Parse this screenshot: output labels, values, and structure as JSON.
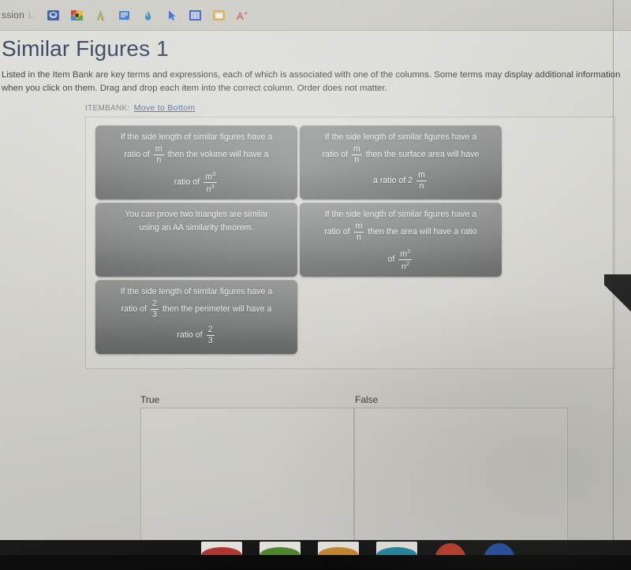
{
  "browser": {
    "tab_title": "ssion",
    "tab_title_faded": "L",
    "bookmarks": [
      {
        "name": "shield-badge-icon",
        "color": "#2a4f9b"
      },
      {
        "name": "colorful-diamond-icon",
        "color": "#c9332a"
      },
      {
        "name": "triangle-a-icon",
        "color": "#8a9a4a"
      },
      {
        "name": "document-lines-icon",
        "color": "#2f6fd0"
      },
      {
        "name": "paint-drop-icon",
        "color": "#2f7ab0"
      },
      {
        "name": "cursor-arrow-icon",
        "color": "#2f5fd0"
      },
      {
        "name": "split-panel-icon",
        "color": "#2a52c8"
      },
      {
        "name": "frame-window-icon",
        "color": "#e0a32a"
      },
      {
        "name": "text-size-increase-icon",
        "color": "#c0303a"
      }
    ]
  },
  "page": {
    "title": "Similar Figures 1",
    "instructions": "Listed in the Item Bank are key terms and expressions, each of which is associated with one of the columns. Some terms may display additional information when you click on them. Drag and drop each item into the correct column. Order does not matter.",
    "itembank_label": "ITEMBANK:",
    "itembank_link": "Move to Bottom",
    "title_color": "#22304f",
    "link_color": "#2a5d9e"
  },
  "item_bank": {
    "cards": [
      {
        "id": "card-volume-ratio",
        "line1": "If the side length of similar figures have a",
        "line2_pre": "ratio of",
        "line2_frac": {
          "num": "m",
          "den": "n"
        },
        "line2_post": "then the volume will have a",
        "line3_pre": "ratio of",
        "line3_frac": {
          "num": "m",
          "num_sup": "3",
          "den": "n",
          "den_sup": "3"
        },
        "line3_post": ""
      },
      {
        "id": "card-surface-area-ratio",
        "line1": "If the side length of similar figures have a",
        "line2_pre": "ratio of",
        "line2_frac": {
          "num": "m",
          "den": "n"
        },
        "line2_post": "then the surface area will have",
        "line3_pre": "a ratio of 2",
        "line3_frac": {
          "num": "m",
          "den": "n"
        },
        "line3_post": ""
      },
      {
        "id": "card-aa-similarity",
        "line1": "You can prove two triangles are similar",
        "line2_pre": "using an AA similarity theorem.",
        "line2_frac": null,
        "line2_post": "",
        "line3_pre": "",
        "line3_frac": null,
        "line3_post": ""
      },
      {
        "id": "card-area-ratio",
        "line1": "If the side length of similar figures have a",
        "line2_pre": "ratio of",
        "line2_frac": {
          "num": "m",
          "den": "n"
        },
        "line2_post": "then the area will have a ratio",
        "line3_pre": "of",
        "line3_frac": {
          "num": "m",
          "num_sup": "2",
          "den": "n",
          "den_sup": "2"
        },
        "line3_post": ""
      },
      {
        "id": "card-perimeter-ratio",
        "line1": "If the side length of similar figures have a",
        "line2_pre": "ratio of",
        "line2_frac": {
          "num": "2",
          "den": "3"
        },
        "line2_post": "then the perimeter will have a",
        "line3_pre": "ratio of",
        "line3_frac": {
          "num": "2",
          "den": "3"
        },
        "line3_post": ""
      }
    ]
  },
  "columns": [
    {
      "id": "column-true",
      "label": "True",
      "items": []
    },
    {
      "id": "column-false",
      "label": "False",
      "items": []
    }
  ],
  "dock": {
    "icons": [
      {
        "name": "dock-icon-photo-red",
        "color": "#b8322b"
      },
      {
        "name": "dock-icon-green-app",
        "color": "#4e8b2a"
      },
      {
        "name": "dock-icon-orange-photo",
        "color": "#d08a2a"
      },
      {
        "name": "dock-icon-teal-orange",
        "color": "#1f8aa8"
      },
      {
        "name": "dock-icon-red-circle",
        "color": "#c23a28"
      },
      {
        "name": "dock-icon-blue-circle",
        "color": "#1f4fa8"
      }
    ]
  }
}
